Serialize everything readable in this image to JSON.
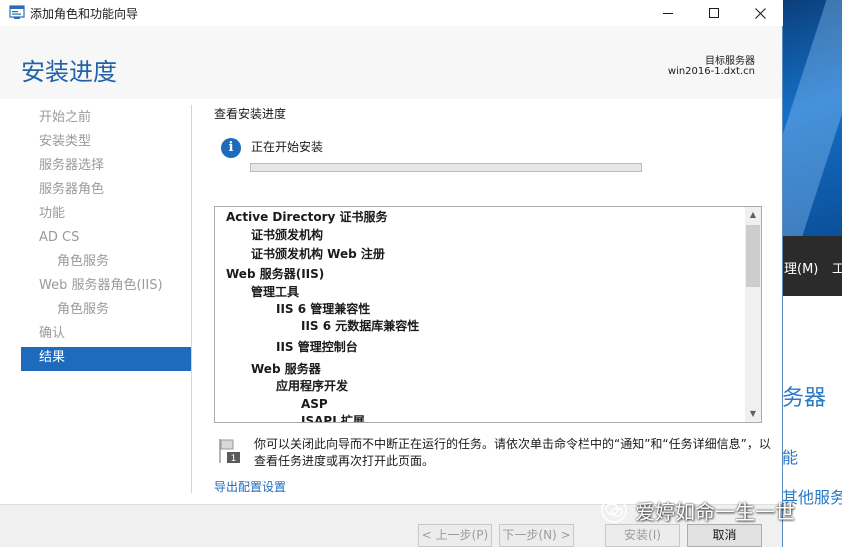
{
  "window": {
    "title": "添加角色和功能向导"
  },
  "header": {
    "heading": "安装进度",
    "target_label": "目标服务器",
    "target_value": "win2016-1.dxt.cn"
  },
  "nav": {
    "items": [
      {
        "label": "开始之前",
        "level": 0,
        "active": false
      },
      {
        "label": "安装类型",
        "level": 0,
        "active": false
      },
      {
        "label": "服务器选择",
        "level": 0,
        "active": false
      },
      {
        "label": "服务器角色",
        "level": 0,
        "active": false
      },
      {
        "label": "功能",
        "level": 0,
        "active": false
      },
      {
        "label": "AD CS",
        "level": 0,
        "active": false
      },
      {
        "label": "角色服务",
        "level": 1,
        "active": false
      },
      {
        "label": "Web 服务器角色(IIS)",
        "level": 0,
        "active": false
      },
      {
        "label": "角色服务",
        "level": 1,
        "active": false
      },
      {
        "label": "确认",
        "level": 0,
        "active": false
      },
      {
        "label": "结果",
        "level": 0,
        "active": true
      }
    ]
  },
  "main": {
    "section_title": "查看安装进度",
    "status_text": "正在开始安装",
    "progress_fraction": 0.0,
    "features": [
      {
        "label": "Active Directory 证书服务",
        "level": 0
      },
      {
        "label": "证书颁发机构",
        "level": 1
      },
      {
        "label": "证书颁发机构 Web 注册",
        "level": 1
      },
      {
        "label": "Web 服务器(IIS)",
        "level": 0
      },
      {
        "label": "管理工具",
        "level": 1
      },
      {
        "label": "IIS 6 管理兼容性",
        "level": 2
      },
      {
        "label": "IIS 6 元数据库兼容性",
        "level": 3
      },
      {
        "label": "IIS 管理控制台",
        "level": 2
      },
      {
        "label": "Web 服务器",
        "level": 1
      },
      {
        "label": "应用程序开发",
        "level": 2
      },
      {
        "label": "ASP",
        "level": 3
      },
      {
        "label": "ISAPI 扩展",
        "level": 3
      }
    ],
    "note_text": "你可以关闭此向导而不中断正在运行的任务。请依次单击命令栏中的“通知”和“任务详细信息”，以查看任务进度或再次打开此页面。",
    "export_link": "导出配置设置"
  },
  "footer": {
    "prev_label": "< 上一步(P)",
    "next_label": "下一步(N) >",
    "install_label": "安装(I)",
    "cancel_label": "取消"
  },
  "background_window": {
    "menu_item_1": "理(M)",
    "menu_item_2": "工",
    "heading_fragment": "务器",
    "link_fragment_1": "能",
    "link_fragment_2": "其他服务"
  },
  "watermark": {
    "text": "爱婷如命一生一世"
  },
  "colors": {
    "accent": "#1e6bbd",
    "heading": "#2162a8",
    "progress_fill": "#06b025"
  }
}
